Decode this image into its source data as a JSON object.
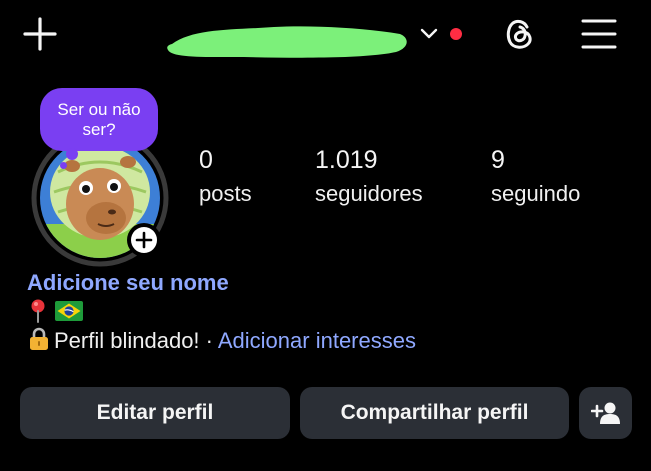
{
  "header": {
    "new_post_icon": "plus-icon",
    "username_redaction_color": "#7cf07a",
    "switch_account_icon": "chevron-down-icon",
    "notification_dot_color": "#ff2d43",
    "threads_icon": "threads-icon",
    "menu_icon": "hamburger-menu-icon"
  },
  "profile": {
    "note_text": "Ser ou não ser?",
    "avatar_ring_color": "#3a3a3a",
    "add_story_icon": "plus-circle-icon",
    "stats": [
      {
        "value": "0",
        "label": "posts"
      },
      {
        "value": "1.019",
        "label": "seguidores"
      },
      {
        "value": "9",
        "label": "seguindo"
      }
    ],
    "add_name_link": "Adicione seu nome",
    "bio_line1_icons": [
      "round-pushpin-icon",
      "brazil-flag-icon"
    ],
    "bio_line2_icon": "lock-icon",
    "bio_line2_text": "Perfil blindado! · ",
    "bio_line2_link": "Adicionar interesses"
  },
  "actions": {
    "edit_profile": "Editar perfil",
    "share_profile": "Compartilhar perfil",
    "discover_people_icon": "add-person-icon"
  },
  "colors": {
    "background": "#000000",
    "button_bg": "#2b2f36",
    "link_blue": "#8fa8ff",
    "note_purple": "#7a3ff2"
  }
}
